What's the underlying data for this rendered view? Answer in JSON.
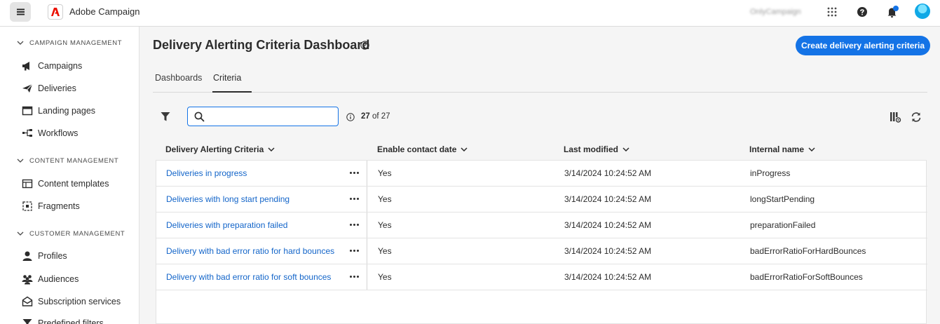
{
  "app": {
    "name": "Adobe Campaign",
    "org": "OnlyCampaign"
  },
  "sidebar": {
    "sections": [
      {
        "label": "CAMPAIGN MANAGEMENT",
        "items": [
          {
            "label": "Campaigns",
            "icon": "megaphone-icon"
          },
          {
            "label": "Deliveries",
            "icon": "paper-plane-icon"
          },
          {
            "label": "Landing pages",
            "icon": "browser-window-icon"
          },
          {
            "label": "Workflows",
            "icon": "workflow-icon"
          }
        ]
      },
      {
        "label": "CONTENT MANAGEMENT",
        "items": [
          {
            "label": "Content templates",
            "icon": "template-icon"
          },
          {
            "label": "Fragments",
            "icon": "fragment-icon"
          }
        ]
      },
      {
        "label": "CUSTOMER MANAGEMENT",
        "items": [
          {
            "label": "Profiles",
            "icon": "user-icon"
          },
          {
            "label": "Audiences",
            "icon": "audience-icon"
          },
          {
            "label": "Subscription services",
            "icon": "envelope-icon"
          },
          {
            "label": "Predefined filters",
            "icon": "filter-icon"
          }
        ]
      }
    ]
  },
  "page": {
    "title": "Delivery Alerting Criteria Dashboard",
    "create_button": "Create delivery alerting criteria",
    "tabs": [
      "Dashboards",
      "Criteria"
    ],
    "active_tab": "Criteria"
  },
  "toolbar": {
    "search_placeholder": "",
    "search_value": "",
    "count_shown": "27",
    "count_of": "of 27"
  },
  "table": {
    "columns": [
      "Delivery Alerting Criteria",
      "Enable contact date",
      "Last modified",
      "Internal name"
    ],
    "rows": [
      {
        "name": "Deliveries in progress",
        "enable": "Yes",
        "modified": "3/14/2024 10:24:52 AM",
        "internal": "inProgress"
      },
      {
        "name": "Deliveries with long start pending",
        "enable": "Yes",
        "modified": "3/14/2024 10:24:52 AM",
        "internal": "longStartPending"
      },
      {
        "name": "Deliveries with preparation failed",
        "enable": "Yes",
        "modified": "3/14/2024 10:24:52 AM",
        "internal": "preparationFailed"
      },
      {
        "name": "Delivery with bad error ratio for hard bounces",
        "enable": "Yes",
        "modified": "3/14/2024 10:24:52 AM",
        "internal": "badErrorRatioForHardBounces"
      },
      {
        "name": "Delivery with bad error ratio for soft bounces",
        "enable": "Yes",
        "modified": "3/14/2024 10:24:52 AM",
        "internal": "badErrorRatioForSoftBounces"
      }
    ]
  },
  "colors": {
    "accent": "#1473e6",
    "link": "#1365c9",
    "brand": "#eb1000"
  }
}
